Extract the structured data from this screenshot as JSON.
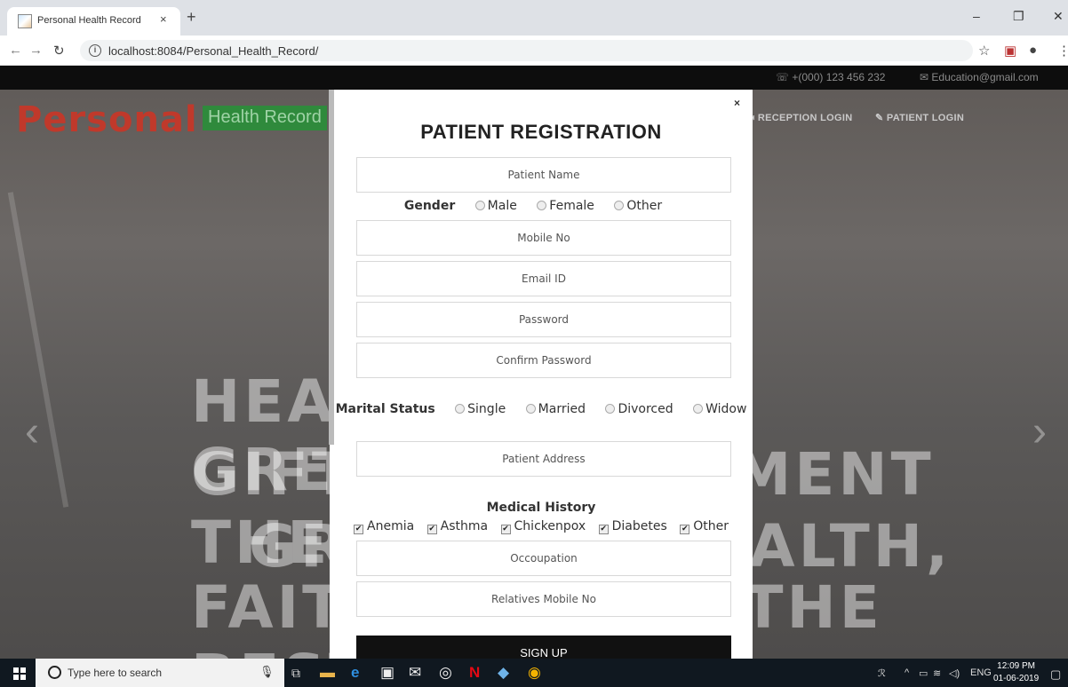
{
  "browser": {
    "tab_title": "Personal Health Record",
    "tab_close": "×",
    "new_tab": "+",
    "url": "localhost:8084/Personal_Health_Record/",
    "controls": {
      "minimize": "–",
      "maximize": "❐",
      "close": "✕"
    },
    "icons": [
      "back-icon",
      "forward-icon",
      "reload-icon",
      "info-icon",
      "star-icon",
      "extension-icon",
      "profile-icon",
      "menu-icon"
    ]
  },
  "site": {
    "contact": {
      "phone": "+(000) 123 456 232",
      "email": "Education@gmail.com"
    },
    "brand": {
      "primary": "Personal",
      "secondary": "Health Record"
    },
    "nav": {
      "reception": "RECEPTION LOGIN",
      "patient": "PATIENT LOGIN"
    },
    "hero_lines": [
      "HEALTH IS THE GREATEST",
      "GIFT, CONTENTMENT THE",
      "GREATEST WEALTH,",
      "FAITHFULNESS THE BEST"
    ],
    "colors": {
      "brand_red": "#c0392b",
      "brand_green": "#2f8a3c"
    }
  },
  "modal": {
    "close": "×",
    "title": "PATIENT REGISTRATION",
    "fields": {
      "patient_name": "Patient Name",
      "mobile": "Mobile No",
      "email": "Email ID",
      "password": "Password",
      "confirm_password": "Confirm Password",
      "address": "Patient Address",
      "occupation": "Occoupation",
      "relatives_mobile": "Relatives Mobile No"
    },
    "gender": {
      "label": "Gender",
      "options": [
        "Male",
        "Female",
        "Other"
      ]
    },
    "marital": {
      "label": "Marital Status",
      "options": [
        "Single",
        "Married",
        "Divorced",
        "Widow"
      ]
    },
    "medical_history": {
      "label": "Medical History",
      "options": [
        "Anemia",
        "Asthma",
        "Chickenpox",
        "Diabetes",
        "Other"
      ]
    },
    "submit": "SIGN UP"
  },
  "taskbar": {
    "search_placeholder": "Type here to search",
    "language": "ENG",
    "time": "12:09 PM",
    "date": "01-06-2019"
  }
}
